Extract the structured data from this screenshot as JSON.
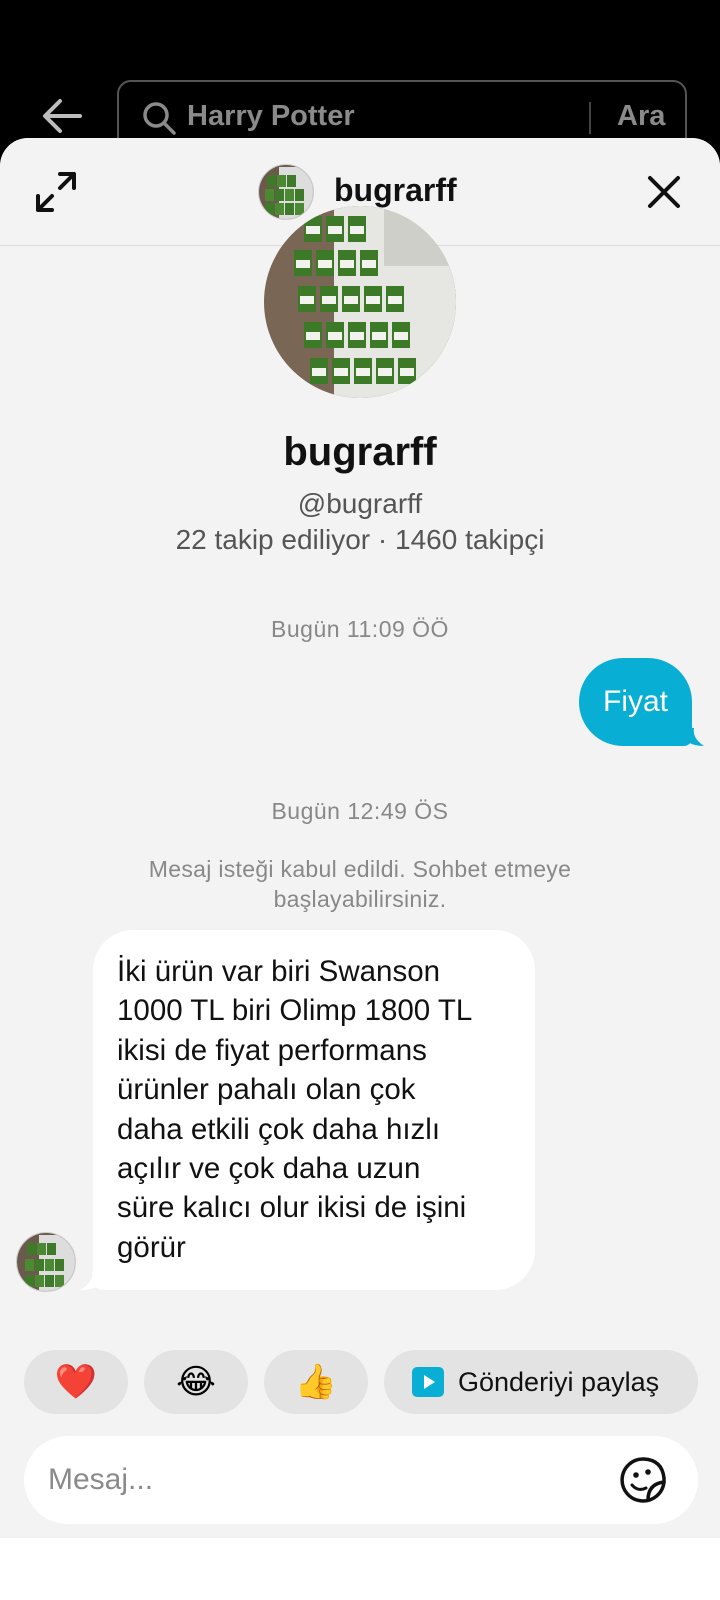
{
  "search": {
    "query": "Harry Potter",
    "button_label": "Ara"
  },
  "header": {
    "name": "bugrarff"
  },
  "profile": {
    "name": "bugrarff",
    "handle": "@bugrarff",
    "stats": "22 takip ediliyor · 1460 takipçi"
  },
  "chat": {
    "timestamp_1": "Bugün 11:09 ÖÖ",
    "outgoing_1": "Fiyat",
    "timestamp_2": "Bugün 12:49 ÖS",
    "system_message": "Mesaj isteği kabul edildi. Sohbet etmeye başlayabilirsiniz.",
    "incoming_lines": [
      "İki ürün var biri Swanson",
      "1000 TL biri Olimp 1800 TL",
      "ikisi de fiyat performans",
      "ürünler pahalı olan çok",
      "daha etkili çok daha hızlı",
      "açılır ve çok daha uzun",
      "süre kalıcı olur ikisi de işini",
      "görür"
    ]
  },
  "reactions": {
    "heart": "❤️",
    "laugh": "😂",
    "thumbs_up": "👍",
    "share_label": "Gönderiyi paylaş"
  },
  "composer": {
    "placeholder": "Mesaj..."
  },
  "colors": {
    "accent": "#09aed4",
    "sheet_bg": "#f3f3f3"
  }
}
